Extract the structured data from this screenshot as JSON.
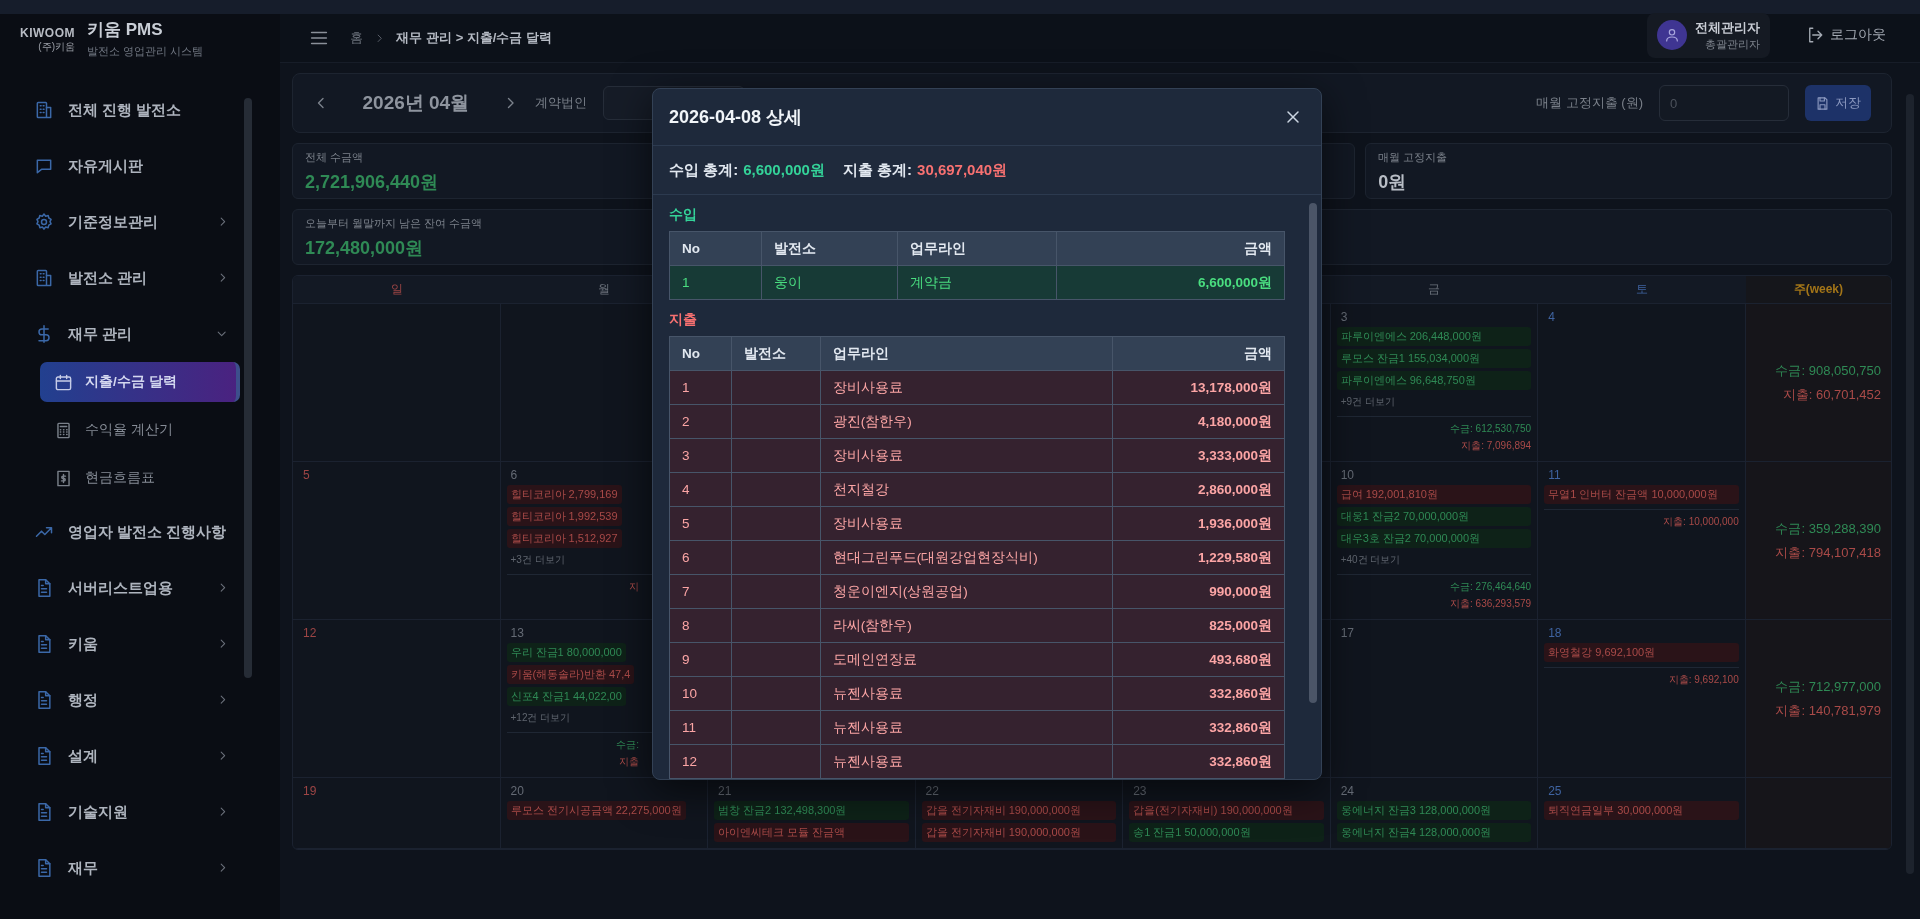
{
  "sidebar": {
    "logo": {
      "mark": "KIWOOM",
      "sub": "(주)키움"
    },
    "title": "키움 PMS",
    "subtitle": "발전소 영업관리 시스템",
    "items": [
      {
        "label": "전체 진행 발전소"
      },
      {
        "label": "자유게시판"
      },
      {
        "label": "기준정보관리",
        "expanded": false
      },
      {
        "label": "발전소 관리",
        "expanded": false
      },
      {
        "label": "재무 관리",
        "expanded": true,
        "children": [
          {
            "label": "지출/수금 달력",
            "selected": true
          },
          {
            "label": "수익율 계산기",
            "selected": false
          },
          {
            "label": "현금흐름표",
            "selected": false
          }
        ]
      },
      {
        "label": "영업자 발전소 진행사항"
      },
      {
        "label": "서버리스트업용",
        "expanded": false
      },
      {
        "label": "키움",
        "expanded": false
      },
      {
        "label": "행정",
        "expanded": false
      },
      {
        "label": "설계",
        "expanded": false
      },
      {
        "label": "기술지원",
        "expanded": false
      },
      {
        "label": "재무",
        "expanded": false
      }
    ]
  },
  "header": {
    "breadcrumb": {
      "home": "홈",
      "path": "재무 관리 > 지출/수금 달력"
    },
    "user": {
      "name": "전체관리자",
      "role": "총괄관리자"
    },
    "logout": "로그아웃"
  },
  "toolbar": {
    "month": "2026년 04월",
    "company_label": "계약법인",
    "fixed_cost": {
      "label": "매월 고정지출 (원)",
      "placeholder": "0"
    },
    "save": "저장"
  },
  "summary_cards": [
    [
      {
        "label": "전체 수금액",
        "value": "2,721,906,440원",
        "kind": "income"
      },
      {
        "label": "매월 고정지출",
        "value": "0원",
        "kind": "neutral"
      }
    ],
    [
      {
        "label": "오늘부터 월말까지 남은 잔여 수금액",
        "value": "172,480,000원",
        "kind": "income"
      }
    ]
  ],
  "calendar": {
    "columns": {
      "sun": "일",
      "mon": "월",
      "fri": "금",
      "sat": "토",
      "week": "주(week)"
    },
    "weeks": [
      {
        "days": {
          "fri": {
            "day": "3",
            "entries": [
              {
                "text": "파루이엔에스 206,448,000원",
                "kind": "income"
              },
              {
                "text": "루모스 잔금1 155,034,000원",
                "kind": "income"
              },
              {
                "text": "파루이엔에스 96,648,750원",
                "kind": "income"
              }
            ],
            "more": "+9건 더보기",
            "totals": [
              {
                "text": "수금: 612,530,750",
                "kind": "income"
              },
              {
                "text": "지출: 7,096,894",
                "kind": "expense"
              }
            ]
          },
          "sat": {
            "day": "4"
          }
        },
        "totals": [
          {
            "text": "수금: 908,050,750",
            "kind": "income"
          },
          {
            "text": "지출: 60,701,452",
            "kind": "expense"
          }
        ]
      },
      {
        "days": {
          "sun": {
            "day": "5"
          },
          "mon": {
            "day": "6",
            "entries": [
              {
                "text": "힐티코리아 2,799,169",
                "kind": "expense"
              },
              {
                "text": "힐티코리아 1,992,539",
                "kind": "expense"
              },
              {
                "text": "힐티코리아 1,512,927",
                "kind": "expense"
              }
            ],
            "more": "+3건 더보기",
            "totals": [
              {
                "text": "지",
                "kind": "expense"
              }
            ]
          },
          "fri": {
            "day": "10",
            "entries": [
              {
                "text": "급여 192,001,810원",
                "kind": "expense"
              },
              {
                "text": "대웅1 잔금2 70,000,000원",
                "kind": "income"
              },
              {
                "text": "대우3호 잔금2 70,000,000원",
                "kind": "income"
              }
            ],
            "more": "+40건 더보기",
            "totals": [
              {
                "text": "수금: 276,464,640",
                "kind": "income"
              },
              {
                "text": "지출: 636,293,579",
                "kind": "expense"
              }
            ]
          },
          "sat": {
            "day": "11",
            "entries": [
              {
                "text": "무열1 인버터 잔금액 10,000,000원",
                "kind": "expense"
              }
            ],
            "totals": [
              {
                "text": "지출: 10,000,000",
                "kind": "expense"
              }
            ]
          }
        },
        "totals": [
          {
            "text": "수금: 359,288,390",
            "kind": "income"
          },
          {
            "text": "지출: 794,107,418",
            "kind": "expense"
          }
        ]
      },
      {
        "days": {
          "sun": {
            "day": "12"
          },
          "mon": {
            "day": "13",
            "entries": [
              {
                "text": "우리 잔금1 80,000,000",
                "kind": "income"
              },
              {
                "text": "키움(해동솔라)반환 47,4",
                "kind": "expense"
              },
              {
                "text": "신포4 잔금1 44,022,00",
                "kind": "income"
              }
            ],
            "more": "+12건 더보기",
            "totals": [
              {
                "text": "수금:",
                "kind": "income"
              },
              {
                "text": "지출",
                "kind": "expense"
              }
            ]
          },
          "fri": {
            "day": "17"
          },
          "sat": {
            "day": "18",
            "entries": [
              {
                "text": "화영철강 9,692,100원",
                "kind": "expense"
              }
            ],
            "totals": [
              {
                "text": "지출: 9,692,100",
                "kind": "expense"
              }
            ]
          }
        },
        "totals": [
          {
            "text": "수금: 712,977,000",
            "kind": "income"
          },
          {
            "text": "지출: 140,781,979",
            "kind": "expense"
          }
        ]
      },
      {
        "days": {
          "sun": {
            "day": "19"
          },
          "mon": {
            "day": "20",
            "entries": [
              {
                "text": "루모스 전기시공금액 22,275,000원",
                "kind": "expense"
              }
            ]
          },
          "tue": {
            "day": "21",
            "entries": [
              {
                "text": "범창 잔금2 132,498,300원",
                "kind": "income"
              },
              {
                "text": "아이엔씨테크 모듈 잔금액",
                "kind": "expense"
              }
            ]
          },
          "wed": {
            "day": "22",
            "entries": [
              {
                "text": "갑을 전기자재비 190,000,000원",
                "kind": "expense"
              },
              {
                "text": "갑을 전기자재비 190,000,000원",
                "kind": "expense"
              }
            ]
          },
          "thu": {
            "day": "23",
            "entries": [
              {
                "text": "갑을(전기자재비) 190,000,000원",
                "kind": "expense"
              },
              {
                "text": "송1 잔금1 50,000,000원",
                "kind": "income"
              }
            ]
          },
          "fri": {
            "day": "24",
            "entries": [
              {
                "text": "웅에너지 잔금3 128,000,000원",
                "kind": "income"
              },
              {
                "text": "웅에너지 잔금4 128,000,000원",
                "kind": "income"
              }
            ]
          },
          "sat": {
            "day": "25",
            "entries": [
              {
                "text": "퇴직연금일부 30,000,000원",
                "kind": "expense"
              }
            ]
          }
        }
      }
    ]
  },
  "modal": {
    "title": "2026-04-08 상세",
    "summary": [
      {
        "label": "수입 총계:",
        "value": "6,600,000원",
        "kind": "income"
      },
      {
        "label": "지출 총계:",
        "value": "30,697,040원",
        "kind": "expense"
      }
    ],
    "sections": [
      {
        "kind": "income",
        "title": "수입",
        "columns": [
          "No",
          "발전소",
          "업무라인",
          "금액"
        ],
        "rows": [
          {
            "no": "1",
            "plant": "웅이",
            "line": "계약금",
            "amount": "6,600,000원"
          }
        ]
      },
      {
        "kind": "expense",
        "title": "지출",
        "columns": [
          "No",
          "발전소",
          "업무라인",
          "금액"
        ],
        "rows": [
          {
            "no": "1",
            "line": "장비사용료",
            "amount": "13,178,000원"
          },
          {
            "no": "2",
            "line": "광진(참한우)",
            "amount": "4,180,000원"
          },
          {
            "no": "3",
            "line": "장비사용료",
            "amount": "3,333,000원"
          },
          {
            "no": "4",
            "line": "천지철강",
            "amount": "2,860,000원"
          },
          {
            "no": "5",
            "line": "장비사용료",
            "amount": "1,936,000원"
          },
          {
            "no": "6",
            "line": "현대그린푸드(대원강업현장식비)",
            "amount": "1,229,580원"
          },
          {
            "no": "7",
            "line": "청운이엔지(상원공업)",
            "amount": "990,000원"
          },
          {
            "no": "8",
            "line": "라씨(참한우)",
            "amount": "825,000원"
          },
          {
            "no": "9",
            "line": "도메인연장료",
            "amount": "493,680원"
          },
          {
            "no": "10",
            "line": "뉴젠사용료",
            "amount": "332,860원"
          },
          {
            "no": "11",
            "line": "뉴젠사용료",
            "amount": "332,860원"
          },
          {
            "no": "12",
            "line": "뉴젠사용료",
            "amount": "332,860원"
          }
        ]
      }
    ]
  }
}
